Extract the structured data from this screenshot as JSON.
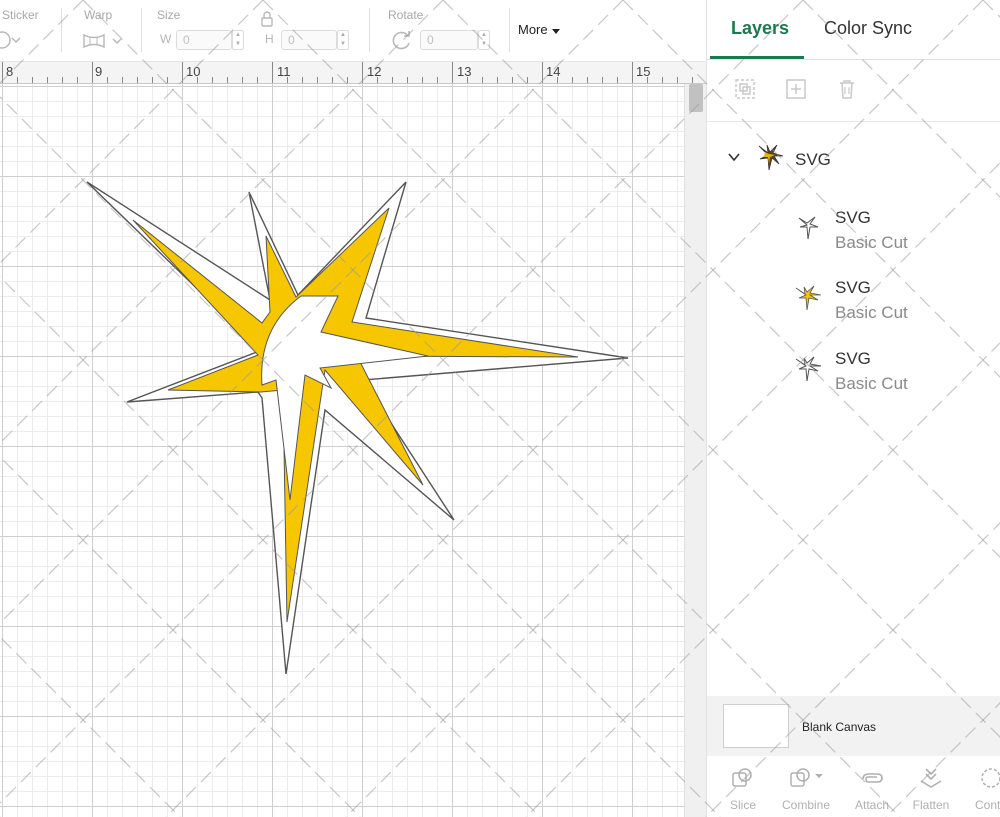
{
  "toolbar": {
    "sticker_label": "Sticker",
    "warp_label": "Warp",
    "size_label": "Size",
    "w_letter": "W",
    "h_letter": "H",
    "width_value": "0",
    "height_value": "0",
    "rotate_label": "Rotate",
    "rotate_value": "0",
    "more_label": "More"
  },
  "ruler": {
    "numbers": [
      "8",
      "9",
      "10",
      "11",
      "12",
      "13",
      "14",
      "15"
    ]
  },
  "panel": {
    "tabs": [
      {
        "label": "Layers",
        "active": true
      },
      {
        "label": "Color Sync",
        "active": false
      }
    ],
    "tools": [
      {
        "icon": "group-icon"
      },
      {
        "icon": "ungroup-icon"
      },
      {
        "icon": "delete-icon"
      }
    ],
    "layers": {
      "group": {
        "name": "SVG",
        "expanded": true
      },
      "children": [
        {
          "name": "SVG",
          "operation": "Basic Cut",
          "color": "#ffffff"
        },
        {
          "name": "SVG",
          "operation": "Basic Cut",
          "color": "#f6c600"
        },
        {
          "name": "SVG",
          "operation": "Basic Cut",
          "color": "#ffffff"
        }
      ]
    },
    "blank_canvas_label": "Blank Canvas",
    "bottom_tools": [
      {
        "label": "Slice",
        "icon": "slice-icon"
      },
      {
        "label": "Combine",
        "icon": "combine-icon"
      },
      {
        "label": "Attach",
        "icon": "attach-icon"
      },
      {
        "label": "Flatten",
        "icon": "flatten-icon"
      },
      {
        "label": "Conto",
        "icon": "contour-icon"
      }
    ]
  },
  "colors": {
    "accent": "#1b7a4d",
    "star_fill": "#f6c600",
    "outline": "#555555"
  }
}
